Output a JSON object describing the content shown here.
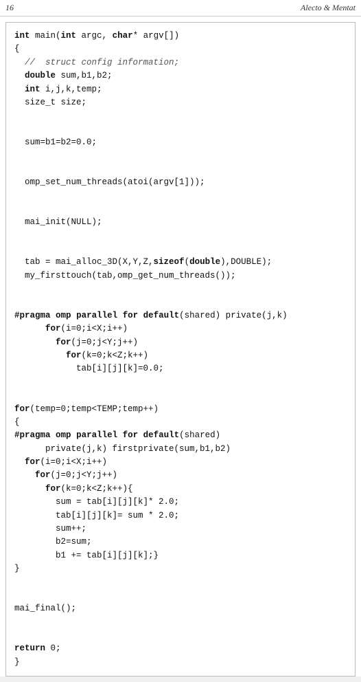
{
  "header": {
    "left": "16",
    "right": "Alecto & Mentat"
  },
  "code": {
    "lines": [
      {
        "id": 1,
        "text": "int main(int argc, char* argv[])",
        "type": "normal"
      },
      {
        "id": 2,
        "text": "{",
        "type": "normal"
      },
      {
        "id": 3,
        "text": "  //  struct config information;",
        "type": "comment"
      },
      {
        "id": 4,
        "text": "  double sum,b1,b2;",
        "type": "normal"
      },
      {
        "id": 5,
        "text": "  int i,j,k,temp;",
        "type": "normal"
      },
      {
        "id": 6,
        "text": "  size_t size;",
        "type": "normal"
      },
      {
        "id": 7,
        "text": "",
        "type": "normal"
      },
      {
        "id": 8,
        "text": "  sum=b1=b2=0.0;",
        "type": "normal"
      },
      {
        "id": 9,
        "text": "",
        "type": "normal"
      },
      {
        "id": 10,
        "text": "  omp_set_num_threads(atoi(argv[1]));",
        "type": "normal"
      },
      {
        "id": 11,
        "text": "",
        "type": "normal"
      },
      {
        "id": 12,
        "text": "  mai_init(NULL);",
        "type": "normal"
      },
      {
        "id": 13,
        "text": "",
        "type": "normal"
      },
      {
        "id": 14,
        "text": "  tab = mai_alloc_3D(X,Y,Z,sizeof(double),DOUBLE);",
        "type": "sizeof"
      },
      {
        "id": 15,
        "text": "  my_firsttouch(tab,omp_get_num_threads());",
        "type": "normal"
      },
      {
        "id": 16,
        "text": "",
        "type": "normal"
      },
      {
        "id": 17,
        "text": "#pragma omp parallel for default(shared) private(j,k)",
        "type": "pragma"
      },
      {
        "id": 18,
        "text": "      for(i=0;i<X;i++)",
        "type": "normal"
      },
      {
        "id": 19,
        "text": "        for(j=0;j<Y;j++)",
        "type": "normal"
      },
      {
        "id": 20,
        "text": "          for(k=0;k<Z;k++)",
        "type": "normal"
      },
      {
        "id": 21,
        "text": "            tab[i][j][k]=0.0;",
        "type": "normal"
      },
      {
        "id": 22,
        "text": "",
        "type": "normal"
      },
      {
        "id": 23,
        "text": "for(temp=0;temp<TEMP;temp++)",
        "type": "forloop"
      },
      {
        "id": 24,
        "text": "{",
        "type": "normal"
      },
      {
        "id": 25,
        "text": "#pragma omp parallel for default(shared)",
        "type": "pragma"
      },
      {
        "id": 26,
        "text": "      private(j,k) firstprivate(sum,b1,b2)",
        "type": "normal"
      },
      {
        "id": 27,
        "text": "  for(i=0;i<X;i++)",
        "type": "normal"
      },
      {
        "id": 28,
        "text": "    for(j=0;j<Y;j++)",
        "type": "normal"
      },
      {
        "id": 29,
        "text": "      for(k=0;k<Z;k++){",
        "type": "normal"
      },
      {
        "id": 30,
        "text": "        sum = tab[i][j][k]* 2.0;",
        "type": "normal"
      },
      {
        "id": 31,
        "text": "        tab[i][j][k]= sum * 2.0;",
        "type": "normal"
      },
      {
        "id": 32,
        "text": "        sum++;",
        "type": "normal"
      },
      {
        "id": 33,
        "text": "        b2=sum;",
        "type": "normal"
      },
      {
        "id": 34,
        "text": "        b1 += tab[i][j][k];}",
        "type": "normal"
      },
      {
        "id": 35,
        "text": "}",
        "type": "normal"
      },
      {
        "id": 36,
        "text": "",
        "type": "normal"
      },
      {
        "id": 37,
        "text": "mai_final();",
        "type": "normal"
      },
      {
        "id": 38,
        "text": "",
        "type": "normal"
      },
      {
        "id": 39,
        "text": "return 0;",
        "type": "normal"
      },
      {
        "id": 40,
        "text": "}",
        "type": "normal"
      }
    ]
  }
}
